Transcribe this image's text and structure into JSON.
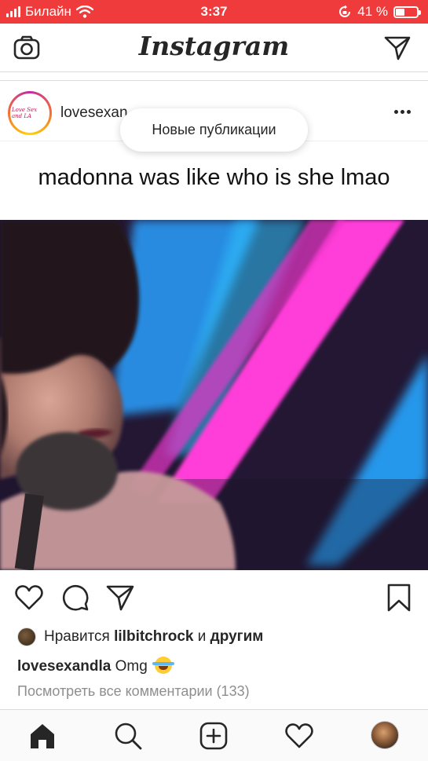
{
  "status_bar": {
    "carrier": "Билайн",
    "time": "3:37",
    "battery_percent": "41 %",
    "battery_level": 0.41,
    "background_color": "#ef3b3b",
    "icons": [
      "signal-icon",
      "wifi-icon",
      "rotation-lock-icon",
      "battery-icon"
    ]
  },
  "header": {
    "logo": "Instagram",
    "icons": [
      "camera-icon",
      "direct-message-icon"
    ]
  },
  "post": {
    "username": "lovesexandla",
    "username_visible": "lovesexan",
    "avatar_text": "Love Sex and LA",
    "caption_overlay": "madonna was like who is she lmao",
    "likes": {
      "prefix": "Нравится",
      "user": "lilbitchrock",
      "conj": "и",
      "others": "другим"
    },
    "caption": {
      "user": "lovesexandla",
      "text": "Omg"
    },
    "view_comments": "Посмотреть все комментарии (133)"
  },
  "toast": {
    "label": "Новые публикации"
  },
  "actions": {
    "icons": [
      "heart-icon",
      "comment-icon",
      "share-icon",
      "bookmark-icon"
    ]
  },
  "tabbar": {
    "icons": [
      "home-icon",
      "search-icon",
      "new-post-icon",
      "activity-icon",
      "profile-avatar"
    ]
  }
}
